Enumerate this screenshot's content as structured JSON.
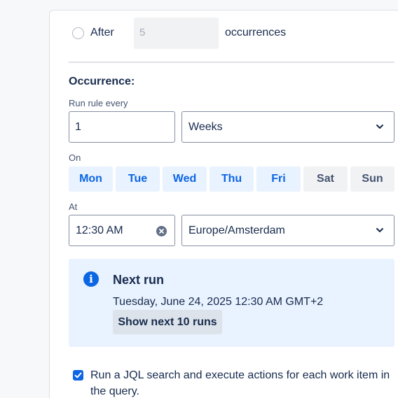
{
  "end_condition": {
    "after_label": "After",
    "after_value": "5",
    "occurrences_label": "occurrences"
  },
  "occurrence": {
    "title": "Occurrence:",
    "run_every_label": "Run rule every",
    "interval_value": "1",
    "unit_value": "Weeks",
    "on_label": "On",
    "days": [
      {
        "label": "Mon",
        "selected": true
      },
      {
        "label": "Tue",
        "selected": true
      },
      {
        "label": "Wed",
        "selected": true
      },
      {
        "label": "Thu",
        "selected": true
      },
      {
        "label": "Fri",
        "selected": true
      },
      {
        "label": "Sat",
        "selected": false
      },
      {
        "label": "Sun",
        "selected": false
      }
    ],
    "at_label": "At",
    "time_value": "12:30 AM",
    "timezone_value": "Europe/Amsterdam"
  },
  "next_run": {
    "icon": "info-icon",
    "title": "Next run",
    "date": "Tuesday, June 24, 2025 12:30 AM GMT+2",
    "button_label": "Show next 10 runs"
  },
  "jql": {
    "checked": true,
    "label": "Run a JQL search and execute actions for each work item in the query."
  },
  "colors": {
    "accent": "#0c66e4",
    "selected_day_bg": "#e9f2ff",
    "info_bg": "#e9f2ff"
  }
}
